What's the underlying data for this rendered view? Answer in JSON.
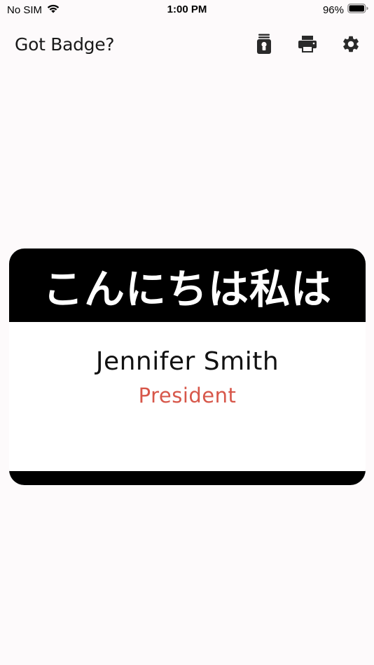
{
  "status_bar": {
    "carrier": "No SIM",
    "time": "1:00 PM",
    "battery_percent": "96%",
    "battery_level": 0.96
  },
  "app_bar": {
    "title": "Got Badge?",
    "icons": [
      "badge-clip-icon",
      "print-icon",
      "gear-icon"
    ]
  },
  "badge": {
    "greeting": "こんにちは私は",
    "name": "Jennifer Smith",
    "role": "President",
    "colors": {
      "frame": "#000000",
      "body": "#ffffff",
      "name": "#111111",
      "role": "#d7574a"
    }
  }
}
